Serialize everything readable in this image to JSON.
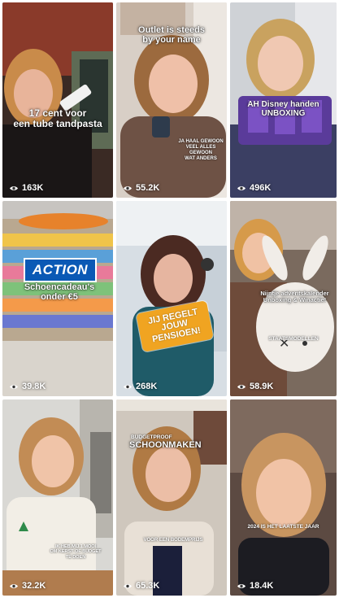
{
  "tiles": [
    {
      "views": "163K",
      "caption": "17 cent voor\neen tube tandpasta"
    },
    {
      "views": "55.2K",
      "caption": "Outlet is steeds\nby your name",
      "sub": "JA HAAL GEWOON\nVEEL ALLES\nGEWOON\nWAT ANDERS"
    },
    {
      "views": "496K",
      "caption": "AH Disney handen\nUNBOXING"
    },
    {
      "views": "39.8K",
      "logo": "ACTION",
      "caption": "Schoencadeau's\nonder €5"
    },
    {
      "views": "268K",
      "banner": "JIJ REGELT\nJOUW\nPENSIOEN!"
    },
    {
      "views": "58.9K",
      "caption": "Nijntje adventskalender\nUnboxing & Winactie!",
      "bunny_label": "STAATSMODELLEN"
    },
    {
      "views": "32.2K",
      "sub": "IK HEB MIJ 1 MOOI\nOM KERST OF BUDGET\nTE DOEN"
    },
    {
      "views": "65.3K",
      "tag": "BUDGETPROOF",
      "caption": "SCHOONMAKEN",
      "sub": "VOOR EEN BODEMPRIJS"
    },
    {
      "views": "18.4K",
      "sub": "2024 IS HET LAATSTE JAAR"
    }
  ],
  "icons": {
    "views": "eye-icon"
  }
}
